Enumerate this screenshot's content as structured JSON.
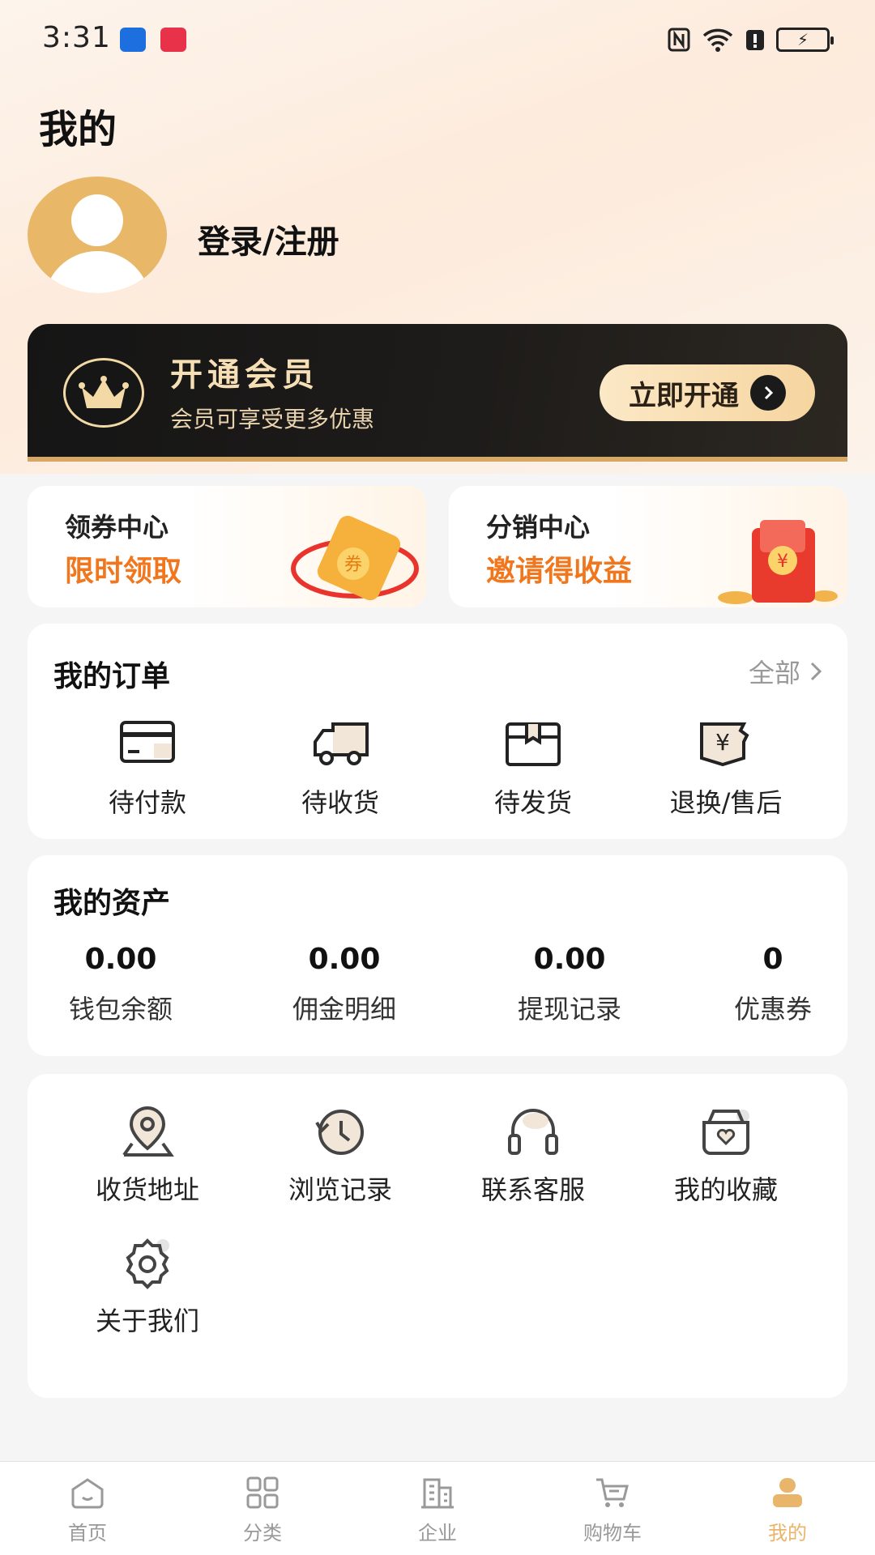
{
  "status_bar": {
    "time": "3:31",
    "battery_icon": "battery-charging-icon"
  },
  "header": {
    "title": "我的"
  },
  "profile": {
    "login_label": "登录/注册"
  },
  "member_banner": {
    "title": "开通会员",
    "subtitle": "会员可享受更多优惠",
    "button_label": "立即开通"
  },
  "promos": [
    {
      "title": "领券中心",
      "subtitle": "限时领取"
    },
    {
      "title": "分销中心",
      "subtitle": "邀请得收益"
    }
  ],
  "orders": {
    "title": "我的订单",
    "all_label": "全部",
    "items": [
      {
        "label": "待付款",
        "icon": "card-icon"
      },
      {
        "label": "待收货",
        "icon": "truck-icon"
      },
      {
        "label": "待发货",
        "icon": "box-icon"
      },
      {
        "label": "退换/售后",
        "icon": "refund-icon"
      }
    ]
  },
  "assets": {
    "title": "我的资产",
    "items": [
      {
        "value": "0.00",
        "label": "钱包余额"
      },
      {
        "value": "0.00",
        "label": "佣金明细"
      },
      {
        "value": "0.00",
        "label": "提现记录"
      },
      {
        "value": "0",
        "label": "优惠券"
      }
    ]
  },
  "services": {
    "items": [
      {
        "label": "收货地址",
        "icon": "location-icon"
      },
      {
        "label": "浏览记录",
        "icon": "history-icon"
      },
      {
        "label": "联系客服",
        "icon": "headset-icon"
      },
      {
        "label": "我的收藏",
        "icon": "favorite-icon"
      },
      {
        "label": "关于我们",
        "icon": "gear-icon"
      }
    ]
  },
  "bottom_nav": {
    "items": [
      {
        "label": "首页",
        "icon": "home-icon"
      },
      {
        "label": "分类",
        "icon": "grid-icon"
      },
      {
        "label": "企业",
        "icon": "building-icon"
      },
      {
        "label": "购物车",
        "icon": "cart-icon"
      },
      {
        "label": "我的",
        "icon": "person-icon"
      }
    ],
    "active_index": 4
  },
  "colors": {
    "accent": "#e9b56a",
    "promo_orange": "#f0771d",
    "member_gold": "#f6dfb5"
  }
}
